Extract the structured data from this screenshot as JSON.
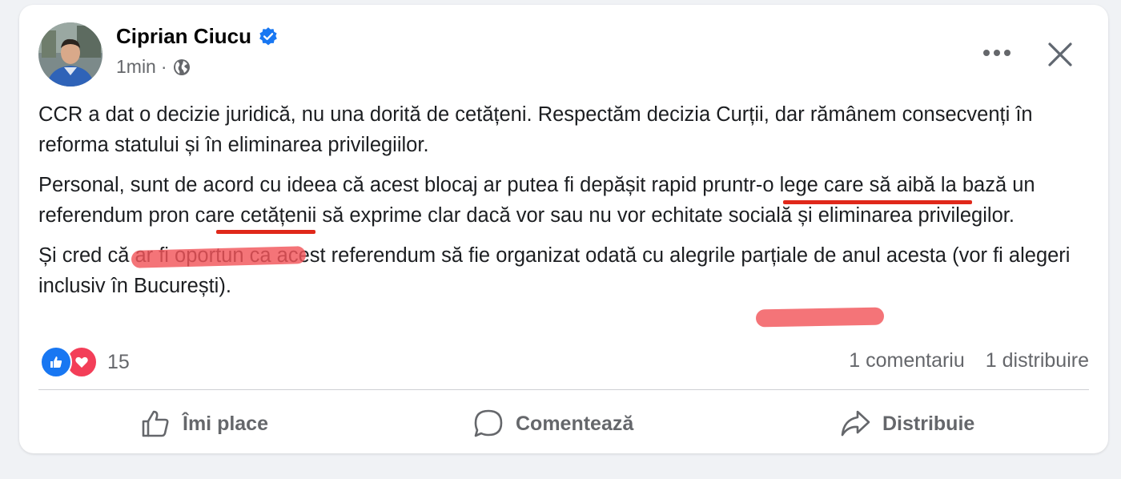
{
  "post": {
    "author": "Ciprian Ciucu",
    "verified": true,
    "time": "1min",
    "separator": "·",
    "audience_icon": "globe-icon",
    "paragraphs": [
      "CCR a dat o decizie juridică, nu una dorită de cetățeni. Respectăm decizia Curții, dar rămânem consecvenți în reforma statului și în eliminarea privilegiilor.",
      "Personal, sunt de acord cu ideea că acest blocaj ar putea fi depășit rapid pruntr-o lege care să aibă la bază un referendum pron care cetățenii să exprime clar dacă vor sau nu vor echitate socială și eliminarea privilegilor.",
      "Și cred că ar fi oportun ca acest referendum să fie organizat odată cu alegrile parțiale de anul acesta (vor fi alegeri inclusiv în București)."
    ]
  },
  "reactions": {
    "count": "15",
    "types": [
      "like-icon",
      "love-icon"
    ]
  },
  "stats": {
    "comments": "1 comentariu",
    "shares": "1 distribuire"
  },
  "actions": {
    "like": "Îmi place",
    "comment": "Comentează",
    "share": "Distribuie"
  },
  "colors": {
    "annotation_red": "#e0281a",
    "like_blue": "#1877f2",
    "love_red": "#f33e58",
    "verified_blue": "#1877f2"
  }
}
